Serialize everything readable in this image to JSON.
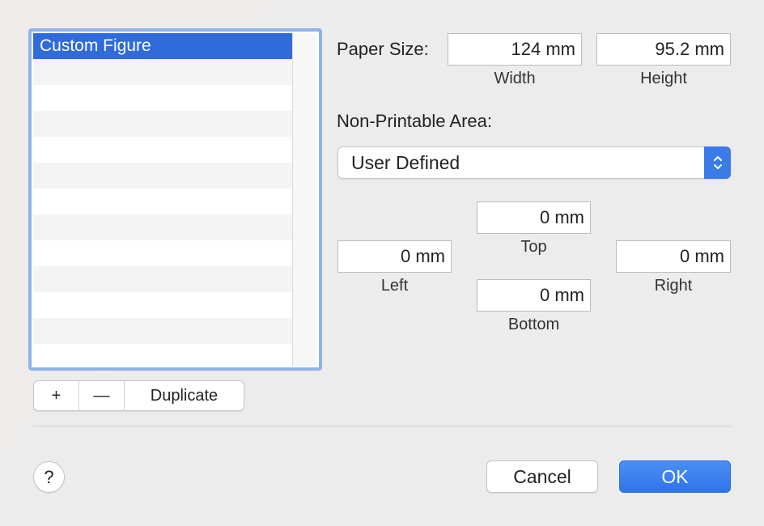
{
  "list": {
    "selected_item": "Custom Figure"
  },
  "list_controls": {
    "add_symbol": "+",
    "remove_symbol": "—",
    "duplicate_label": "Duplicate"
  },
  "paper_size": {
    "label": "Paper Size:",
    "width_value": "124 mm",
    "width_caption": "Width",
    "height_value": "95.2 mm",
    "height_caption": "Height"
  },
  "non_printable": {
    "label": "Non-Printable Area:",
    "selected": "User Defined"
  },
  "margins": {
    "top_value": "0 mm",
    "top_caption": "Top",
    "left_value": "0 mm",
    "left_caption": "Left",
    "right_value": "0 mm",
    "right_caption": "Right",
    "bottom_value": "0 mm",
    "bottom_caption": "Bottom"
  },
  "footer": {
    "help_symbol": "?",
    "cancel_label": "Cancel",
    "ok_label": "OK"
  },
  "colors": {
    "accent": "#2f6cda",
    "focus_ring": "#8fb2ea"
  },
  "icons": {
    "popup": "chevron-up-down-icon"
  }
}
